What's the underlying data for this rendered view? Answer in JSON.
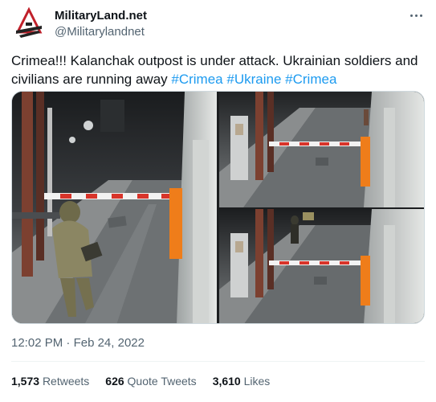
{
  "author": {
    "display_name": "MilitaryLand.net",
    "handle": "@Militarylandnet",
    "avatar_icon": "militaryland-logo-icon"
  },
  "tweet": {
    "text": "Crimea!!! Kalanchak outpost is under attack. Ukrainian soldiers and civilians are running away",
    "hashtags": [
      "#Crimea",
      "#Ukraine",
      "#Crimea"
    ]
  },
  "media": [
    {
      "kind": "cctv-still"
    },
    {
      "kind": "cctv-still"
    },
    {
      "kind": "cctv-still"
    }
  ],
  "meta": {
    "time": "12:02 PM",
    "separator": "·",
    "date": "Feb 24, 2022"
  },
  "stats": {
    "retweets_count": "1,573",
    "retweets_label": "Retweets",
    "quotes_count": "626",
    "quotes_label": "Quote Tweets",
    "likes_count": "3,610",
    "likes_label": "Likes"
  },
  "colors": {
    "link": "#1d9bf0",
    "secondary_text": "#536471",
    "primary_text": "#0f1419",
    "barrier_stripe": "#d8342a",
    "barrier_post": "#ef7d1a"
  }
}
